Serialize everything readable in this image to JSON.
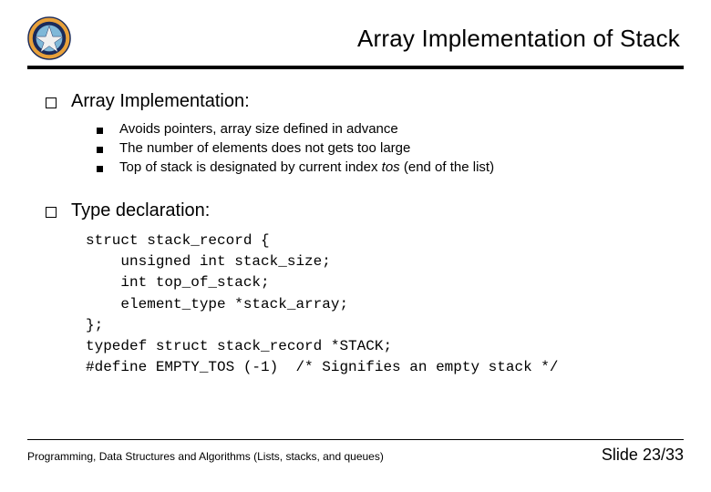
{
  "title": "Array Implementation of Stack",
  "sections": [
    {
      "heading": "Array Implementation:",
      "bullets": [
        "Avoids pointers, array size defined in advance",
        "The number of elements does not gets too large",
        "Top of stack is designated by current index <i>tos</i> (end of the list)"
      ]
    },
    {
      "heading": "Type declaration:",
      "code": "struct stack_record {\n    unsigned int stack_size;\n    int top_of_stack;\n    element_type *stack_array;\n};\ntypedef struct stack_record *STACK;\n#define EMPTY_TOS (-1)  /* Signifies an empty stack */"
    }
  ],
  "footer": {
    "left": "Programming, Data Structures and Algorithms  (Lists, stacks, and queues)",
    "right": "Slide 23/33"
  }
}
